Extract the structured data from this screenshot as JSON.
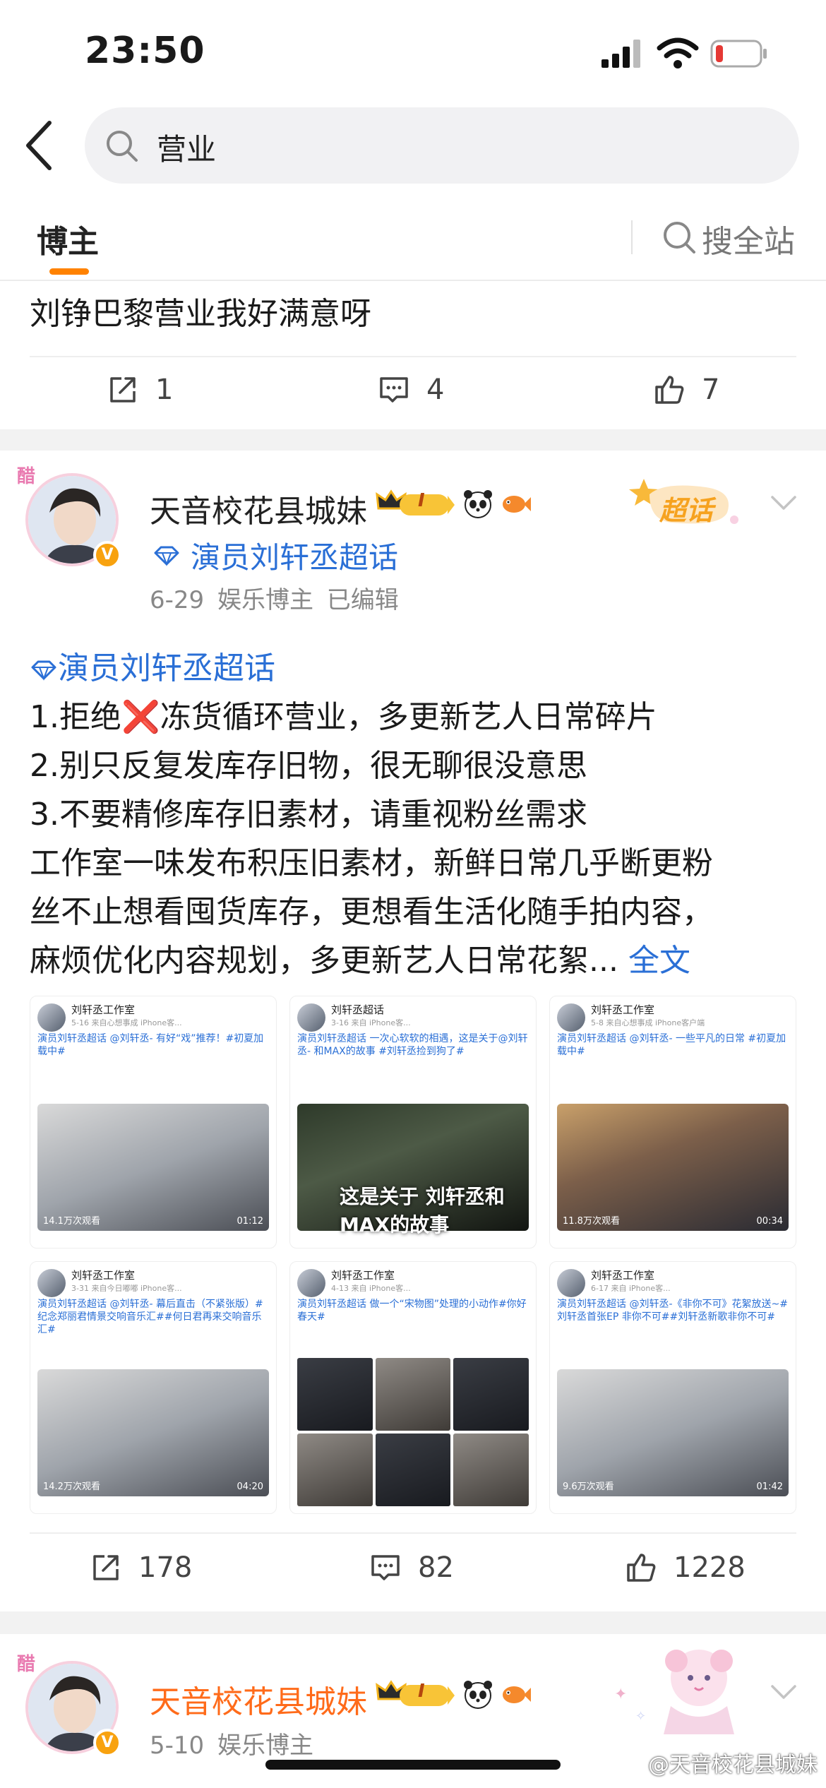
{
  "status_bar": {
    "time": "23:50"
  },
  "search": {
    "query": "营业"
  },
  "tabs": {
    "active": "博主",
    "search_all": "搜全站"
  },
  "post1": {
    "text": "刘铮巴黎营业我好满意呀",
    "reposts": "1",
    "comments": "4",
    "likes": "7"
  },
  "post2": {
    "author": "天音校花县城妹",
    "avatar_tag": "醋",
    "vip_level": "I",
    "topic": "演员刘轩丞超话",
    "meta": "6-29 娱乐博主 已编辑",
    "chaohua_badge": "超话",
    "body": {
      "topic": "演员刘轩丞超话",
      "line1a": "1.拒绝",
      "line1_mark": "❌",
      "line1b": "冻货循环营业，多更新艺人日常碎片",
      "line2": "2.别只反复发库存旧物，很无聊很没意思",
      "line3": "3.不要精修库存旧素材，请重视粉丝需求",
      "line4": "工作室一味发布积压旧素材，新鲜日常几乎断更粉",
      "line5": "丝不止想看囤货库存，更想看生活化随手拍内容，",
      "line6": "麻烦优化内容规划，多更新艺人日常花絮...",
      "more": "全文"
    },
    "images": [
      {
        "name": "刘轩丞工作室",
        "src": "5-16 来自心想事成 iPhone客...",
        "desc": "演员刘轩丞超话 @刘轩丞- 有好“戏”推荐！#初夏加载中#",
        "views": "14.1万次观看",
        "duration": "01:12"
      },
      {
        "name": "刘轩丞超话",
        "src": "3-16 来自 iPhone客...",
        "desc": "演员刘轩丞超话 一次心软软的相遇，这是关于@刘轩丞- 和MAX的故事 #刘轩丞捡到狗了#",
        "caption": "这是关于 刘轩丞和MAX的故事",
        "views": "",
        "duration": ""
      },
      {
        "name": "刘轩丞工作室",
        "src": "5-8 来自心想事成 iPhone客户端",
        "desc": "演员刘轩丞超话 @刘轩丞- 一些平凡的日常 #初夏加载中#",
        "views": "11.8万次观看",
        "duration": "00:34"
      },
      {
        "name": "刘轩丞工作室",
        "src": "3-31 来自今日嘟嘟 iPhone客...",
        "desc": "演员刘轩丞超话 @刘轩丞- 幕后直击（不紧张版）#纪念郑丽君情景交响音乐汇##何日君再来交响音乐汇#",
        "views": "14.2万次观看",
        "duration": "04:20"
      },
      {
        "name": "刘轩丞工作室",
        "src": "4-13 来自 iPhone客...",
        "desc": "演员刘轩丞超话 做一个“宋物图”处理的小动作#你好春天#",
        "views": "",
        "duration": ""
      },
      {
        "name": "刘轩丞工作室",
        "src": "6-17 来自 iPhone客...",
        "desc": "演员刘轩丞超话 @刘轩丞-《非你不可》花絮放送~#刘轩丞首张EP 非你不可##刘轩丞新歌非你不可#",
        "views": "9.6万次观看",
        "duration": "01:42"
      }
    ],
    "reposts": "178",
    "comments": "82",
    "likes": "1228"
  },
  "post3": {
    "author": "天音校花县城妹",
    "avatar_tag": "醋",
    "vip_level": "I",
    "meta": "5-10 娱乐博主"
  },
  "watermark": "@天音校花县城妹",
  "colors": {
    "accent": "#ff8200",
    "link": "#2a6fd6",
    "vip_name": "#ff6b1a"
  }
}
